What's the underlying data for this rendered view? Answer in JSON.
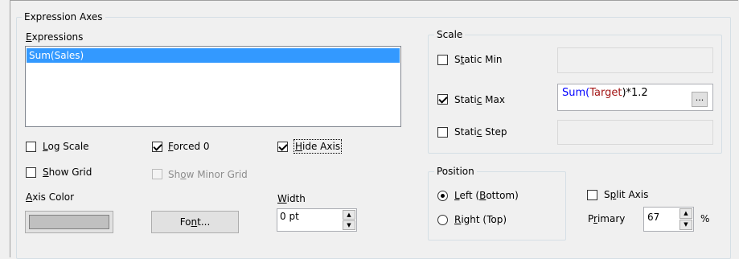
{
  "expression_axes": {
    "title": "Expression Axes",
    "expressions_label_u": "E",
    "expressions_label_rest": "xpressions",
    "expressions": [
      "Sum(Sales)"
    ],
    "log_scale_u": "L",
    "log_scale_rest": "og Scale",
    "forced0_u": "F",
    "forced0_rest": "orced 0",
    "hide_axis_u": "H",
    "hide_axis_rest": "ide Axis",
    "show_grid_u": "S",
    "show_grid_rest": "how Grid",
    "show_minor_pre": "Sh",
    "show_minor_u": "o",
    "show_minor_rest": "w Minor Grid",
    "axis_color_u": "A",
    "axis_color_rest": "xis Color",
    "axis_color_value": "#c0c0c0",
    "font_pre": "Fo",
    "font_u": "n",
    "font_rest": "t...",
    "width_u": "W",
    "width_rest": "idth",
    "width_value": "0 pt",
    "states": {
      "log_scale": false,
      "forced0": true,
      "hide_axis": true,
      "show_grid": false,
      "show_minor_grid": false
    }
  },
  "scale": {
    "title": "Scale",
    "static_min_pre": "S",
    "static_min_u": "t",
    "static_min_rest": "atic Min",
    "static_max_pre": "Stati",
    "static_max_u": "c",
    "static_max_rest": " Max",
    "static_step_pre": "Stati",
    "static_step_u": "c",
    "static_step_rest": " Step",
    "static_max_expr_a": "Sum(",
    "static_max_expr_b": "Target",
    "static_max_expr_c": ")*1.2",
    "browse_label": "...",
    "states": {
      "static_min": false,
      "static_max": true,
      "static_step": false
    }
  },
  "position": {
    "title": "Position",
    "left_u": "L",
    "left_rest": "eft (",
    "left_u2": "B",
    "left_rest2": "ottom)",
    "right_u": "R",
    "right_rest": "ight (Top)",
    "selected": "left"
  },
  "split_axis": {
    "label_pre": "S",
    "label_u": "p",
    "label_rest": "lit Axis",
    "checked": false,
    "primary_pre": "P",
    "primary_u": "r",
    "primary_rest": "imary",
    "primary_value": "67",
    "percent": "%"
  },
  "colors": {
    "selection": "#3399ff",
    "expr_blue": "#0000ff",
    "expr_red": "#a31515"
  }
}
